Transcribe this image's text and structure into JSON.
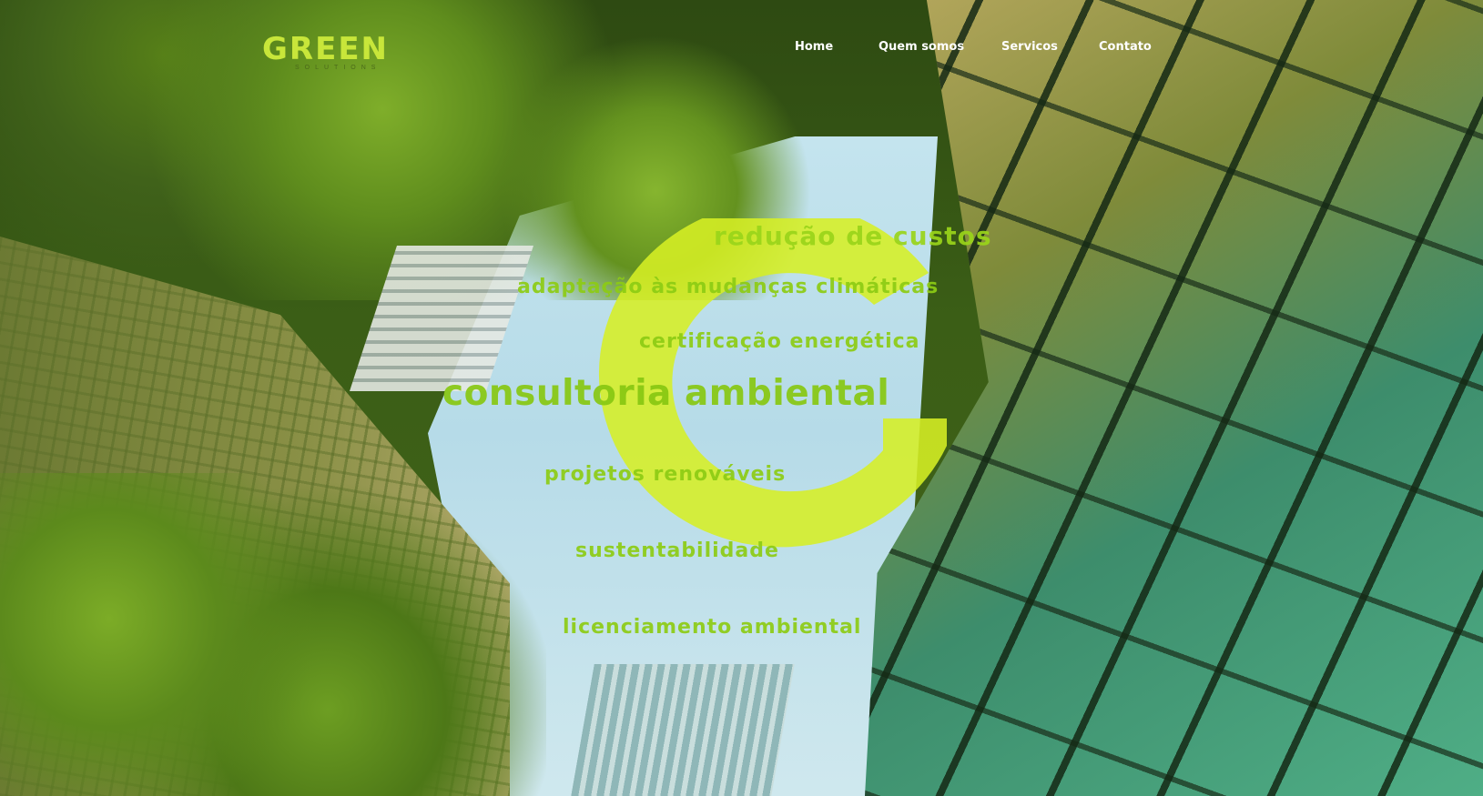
{
  "brand": {
    "name": "GREEN",
    "tagline": "SOLUTIONS",
    "accent_color": "#c8e63a",
    "word_color": "#8dcc14"
  },
  "nav": {
    "items": [
      {
        "label": "Home"
      },
      {
        "label": "Quem somos"
      },
      {
        "label": "Servicos"
      },
      {
        "label": "Contato"
      }
    ]
  },
  "hero": {
    "words": {
      "reducao": "redução de custos",
      "adaptacao": "adaptação às mudanças climáticas",
      "certificacao": "certificação energética",
      "consultoria": "consultoria ambiental",
      "projetos": "projetos renováveis",
      "sustentabilidade": "sustentabilidade",
      "licenciamento": "licenciamento ambiental"
    }
  }
}
